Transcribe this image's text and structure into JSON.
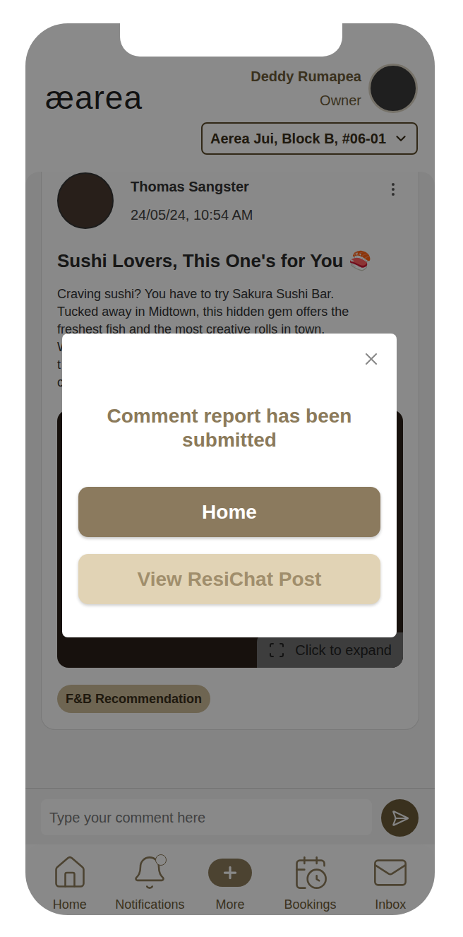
{
  "header": {
    "logo": "æarea",
    "user": {
      "name": "Deddy Rumapea",
      "role": "Owner"
    },
    "unit_selector": {
      "value": "Aerea Jui, Block B, #06-01"
    }
  },
  "post": {
    "author": "Thomas Sangster",
    "timestamp": "24/05/24, 10:54 AM",
    "title": "Sushi Lovers, This One's for You",
    "title_emoji": "🍣",
    "body_lines": [
      "Craving sushi? You have to try Sakura Sushi Bar.",
      "Tucked away in Midtown, this hidden gem offers the",
      "freshest fish and the most creative rolls in town.",
      "W",
      "t",
      "c"
    ],
    "image": {
      "expand_label": "Click to expand"
    },
    "tag": "F&B Recommendation"
  },
  "comment_bar": {
    "placeholder": "Type your comment here"
  },
  "nav": [
    {
      "label": "Home",
      "kind": "home",
      "badge": false
    },
    {
      "label": "Notifications",
      "kind": "notifications",
      "badge": true
    },
    {
      "label": "More",
      "kind": "more",
      "badge": false
    },
    {
      "label": "Bookings",
      "kind": "bookings",
      "badge": false
    },
    {
      "label": "Inbox",
      "kind": "inbox",
      "badge": false
    }
  ],
  "dialog": {
    "message": "Comment report has been submitted",
    "buttons": [
      {
        "label": "Home",
        "kind": "primary"
      },
      {
        "label": "View ResiChat Post",
        "kind": "secondary"
      }
    ]
  }
}
